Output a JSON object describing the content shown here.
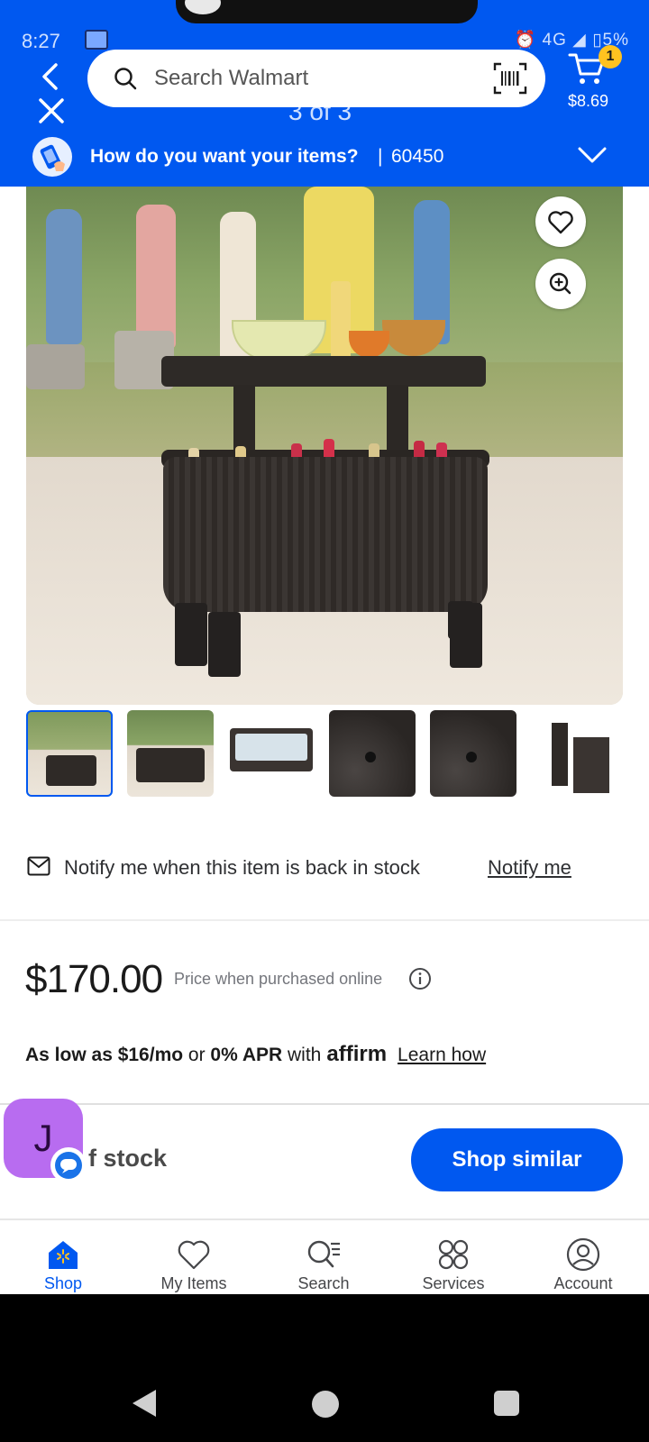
{
  "status_bar": {
    "time": "8:27",
    "right": "⏰ 4G ◢ ▯5%"
  },
  "header": {
    "search_placeholder": "Search Walmart",
    "image_counter": "3 of 3",
    "cart_count": "1",
    "cart_total": "$8.69",
    "fulfillment_prompt": "How do you want your items?",
    "fulfillment_separator": "|",
    "zip": "60450"
  },
  "gallery": {
    "thumbnail_count": 6,
    "selected_index": 0
  },
  "notify": {
    "text": "Notify me when this item is back in stock",
    "link": "Notify me"
  },
  "pricing": {
    "price": "$170.00",
    "note": "Price when purchased online",
    "financing_prefix": "As low as ",
    "financing_amount": "$16/mo",
    "financing_or": " or ",
    "financing_apr": "0% APR",
    "financing_with": " with",
    "affirm_logo": "affirm",
    "learn_how": "Learn how"
  },
  "availability": {
    "stock_text": "f stock",
    "shop_similar": "Shop similar"
  },
  "chat_head": {
    "initial": "J"
  },
  "bottom_nav": {
    "items": [
      {
        "label": "Shop",
        "icon": "shop-icon"
      },
      {
        "label": "My Items",
        "icon": "heart-icon"
      },
      {
        "label": "Search",
        "icon": "search-list-icon"
      },
      {
        "label": "Services",
        "icon": "services-icon"
      },
      {
        "label": "Account",
        "icon": "account-icon"
      }
    ],
    "active_index": 0
  },
  "colors": {
    "brand_blue": "#0058f0",
    "spark_yellow": "#ffc220",
    "chat_purple": "#b86cf0"
  }
}
